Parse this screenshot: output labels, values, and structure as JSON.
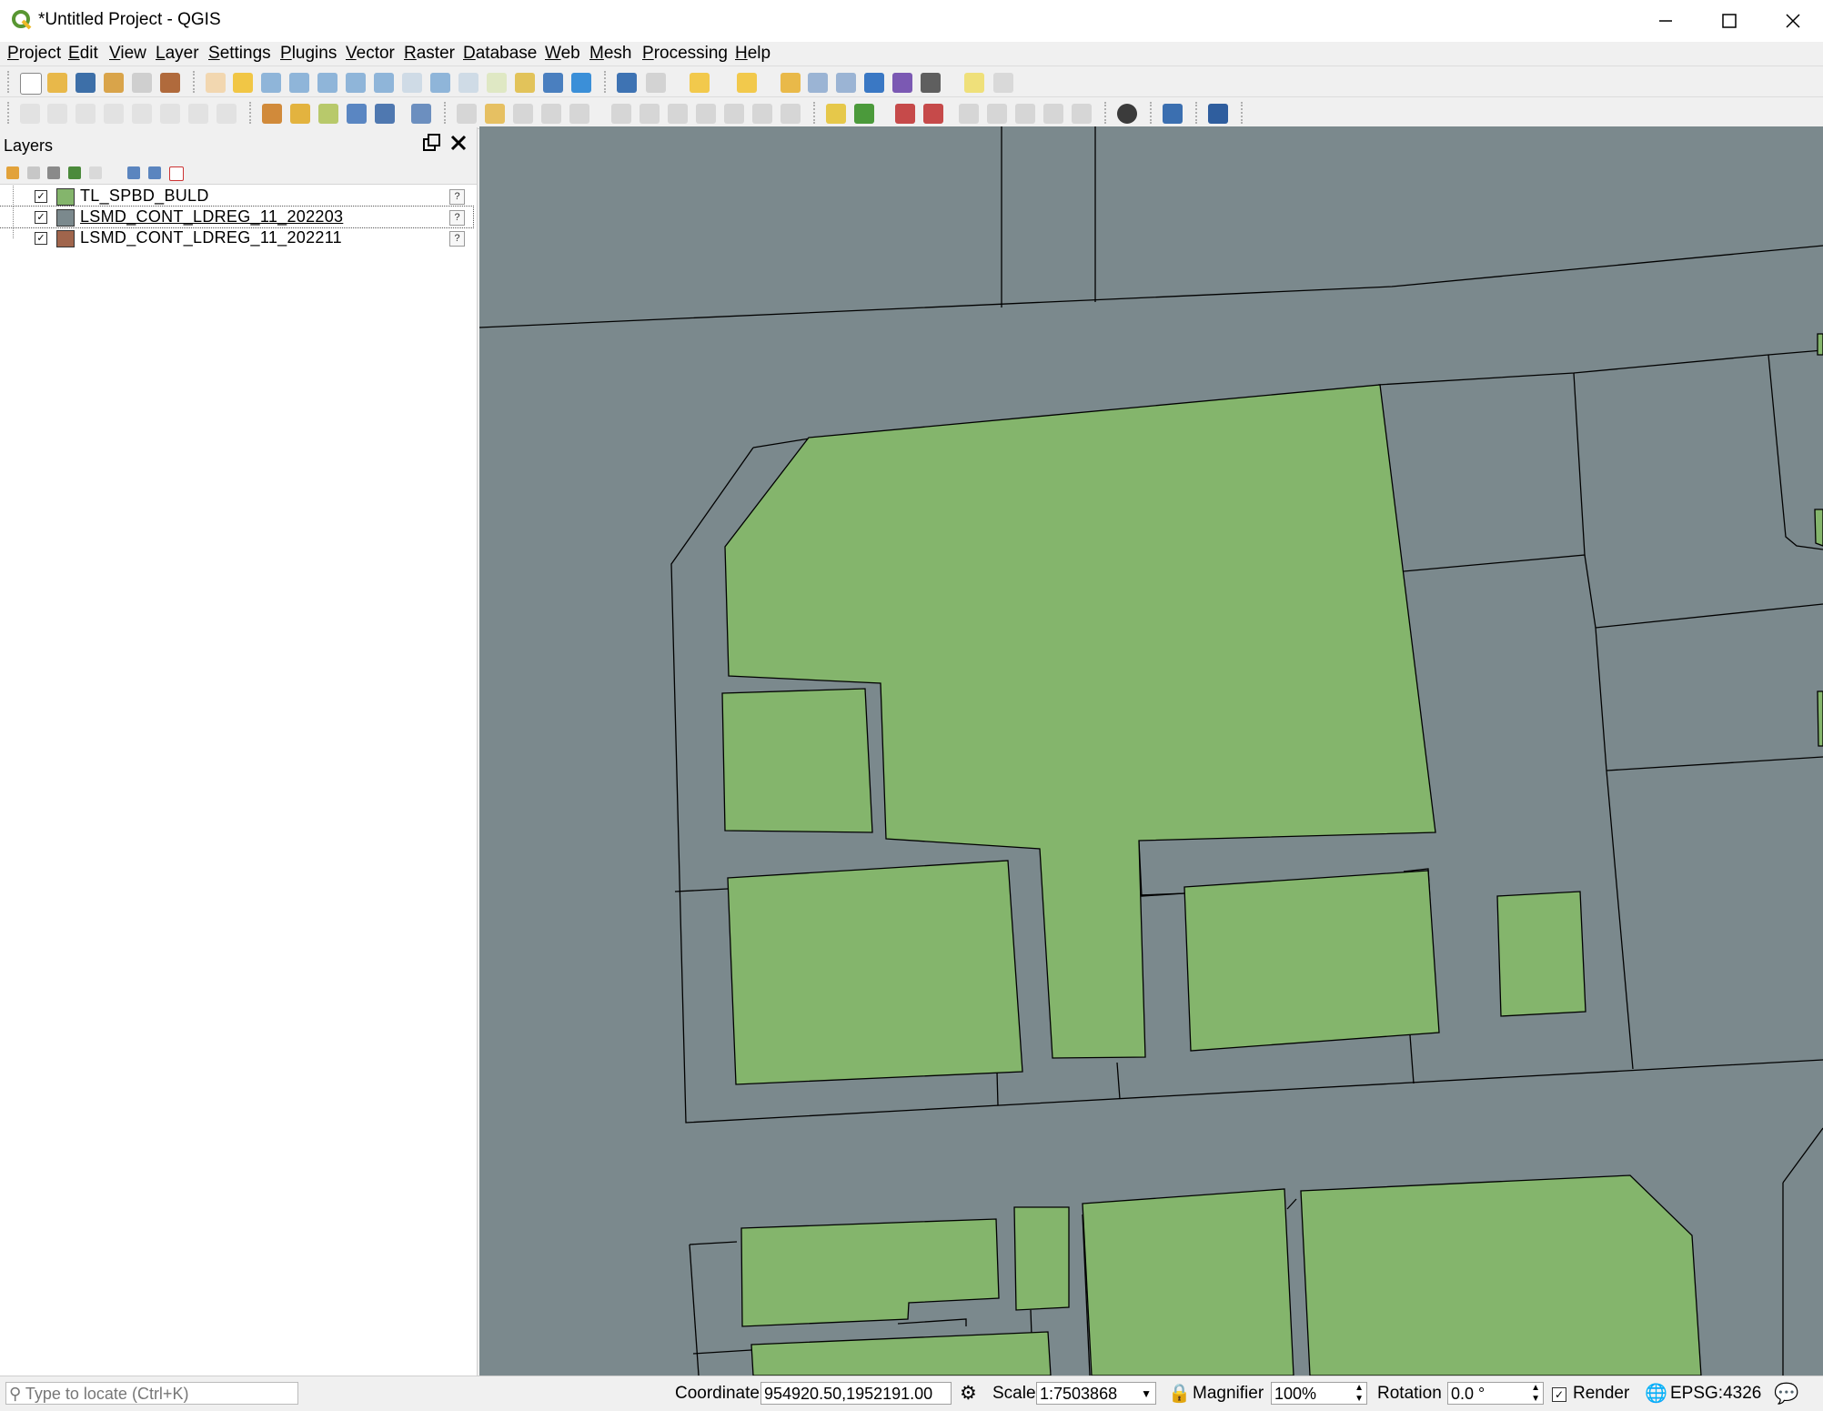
{
  "window": {
    "title": "*Untitled Project - QGIS",
    "app_icon": "qgis-logo-icon",
    "controls": [
      "minimize-icon",
      "maximize-icon",
      "close-icon"
    ]
  },
  "menu": [
    "Project",
    "Edit",
    "View",
    "Layer",
    "Settings",
    "Plugins",
    "Vector",
    "Raster",
    "Database",
    "Web",
    "Mesh",
    "Processing",
    "Help"
  ],
  "layers_panel": {
    "title": "Layers",
    "layers": [
      {
        "name": "TL_SPBD_BULD",
        "checked": true,
        "color": "#84b56c",
        "selected": false
      },
      {
        "name": "LSMD_CONT_LDREG_11_202203",
        "checked": true,
        "color": "#7b898d",
        "selected": true
      },
      {
        "name": "LSMD_CONT_LDREG_11_202211",
        "checked": true,
        "color": "#a0654c",
        "selected": false
      }
    ]
  },
  "map": {
    "background_color": "#7b898d",
    "building_fill": "#84b56c",
    "stroke": "#000000"
  },
  "status": {
    "locator_placeholder": "Type to locate (Ctrl+K)",
    "coordinate_label": "Coordinate",
    "coordinate_value": "954920.50,1952191.00",
    "scale_label": "Scale",
    "scale_value": "1:7503868",
    "magnifier_label": "Magnifier",
    "magnifier_value": "100%",
    "rotation_label": "Rotation",
    "rotation_value": "0.0 °",
    "render_label": "Render",
    "render_checked": true,
    "crs": "EPSG:4326"
  }
}
